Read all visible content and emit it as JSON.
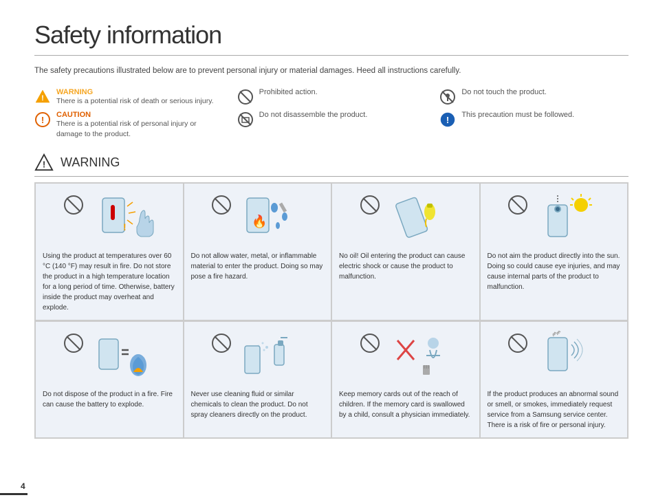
{
  "page": {
    "title": "Safety information",
    "intro": "The safety precautions illustrated below are to prevent personal injury or material damages. Heed all instructions carefully.",
    "page_number": "4"
  },
  "legend": {
    "items": [
      {
        "type": "warning",
        "label": "WARNING",
        "desc": "There is a potential risk of death or serious injury.",
        "icon": "warning-triangle-icon"
      },
      {
        "type": "prohibited",
        "label": "",
        "desc": "Prohibited action.",
        "icon": "prohibited-icon"
      },
      {
        "type": "no-touch",
        "label": "",
        "desc": "Do not touch the product.",
        "icon": "no-touch-icon"
      },
      {
        "type": "caution",
        "label": "CAUTION",
        "desc": "There is a potential risk of personal injury or damage to the product.",
        "icon": "caution-icon"
      },
      {
        "type": "no-disassemble",
        "label": "",
        "desc": "Do not disassemble the product.",
        "icon": "no-disassemble-icon"
      },
      {
        "type": "must-follow",
        "label": "",
        "desc": "This precaution must be followed.",
        "icon": "must-follow-icon"
      }
    ]
  },
  "warning_section": {
    "title": "WARNING"
  },
  "cards": [
    {
      "id": "card-1",
      "text": "Using the product at temperatures over 60 °C (140 °F) may result in fire. Do not store the product in a high temperature location for a long period of time. Otherwise, battery inside the product may overheat and explode."
    },
    {
      "id": "card-2",
      "text": "Do not allow water, metal, or inflammable material to enter the product. Doing so may pose a fire hazard."
    },
    {
      "id": "card-3",
      "text": "No oil! Oil entering the product can cause electric shock or cause the product to malfunction."
    },
    {
      "id": "card-4",
      "text": "Do not aim the product directly into the sun. Doing so could cause eye injuries, and may cause internal parts of the product to malfunction."
    },
    {
      "id": "card-5",
      "text": "Do not dispose of the product in a fire. Fire can cause the battery to explode."
    },
    {
      "id": "card-6",
      "text": "Never use cleaning fluid or similar chemicals to clean the product. Do not spray cleaners directly on the product."
    },
    {
      "id": "card-7",
      "text": "Keep memory cards out of the reach of children. If the memory card is swallowed by a child, consult a physician immediately."
    },
    {
      "id": "card-8",
      "text": "If the product produces an abnormal sound or smell, or smokes, immediately request service from a Samsung service center. There is a risk of fire or personal injury."
    }
  ]
}
